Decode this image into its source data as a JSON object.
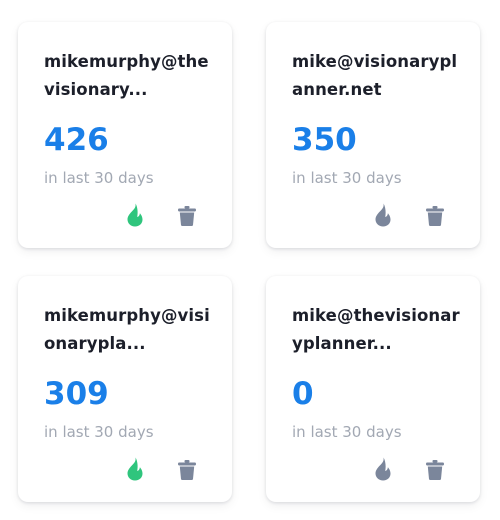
{
  "colors": {
    "count_blue": "#1a7fe8",
    "flame_active": "#2fc57d",
    "flame_inactive": "#7b869b",
    "trash": "#7b869b"
  },
  "cards": [
    {
      "email": "mikemurphy@thevisionary...",
      "count": "426",
      "period": "in last 30 days",
      "flame_icon": "flame-icon",
      "flame_state": "active",
      "trash_icon": "trash-icon"
    },
    {
      "email": "mike@visionaryplanner.net",
      "count": "350",
      "period": "in last 30 days",
      "flame_icon": "flame-icon",
      "flame_state": "inactive",
      "trash_icon": "trash-icon"
    },
    {
      "email": "mikemurphy@visionarypla...",
      "count": "309",
      "period": "in last 30 days",
      "flame_icon": "flame-icon",
      "flame_state": "active",
      "trash_icon": "trash-icon"
    },
    {
      "email": "mike@thevisionaryplanner...",
      "count": "0",
      "period": "in last 30 days",
      "flame_icon": "flame-icon",
      "flame_state": "inactive",
      "trash_icon": "trash-icon"
    }
  ]
}
